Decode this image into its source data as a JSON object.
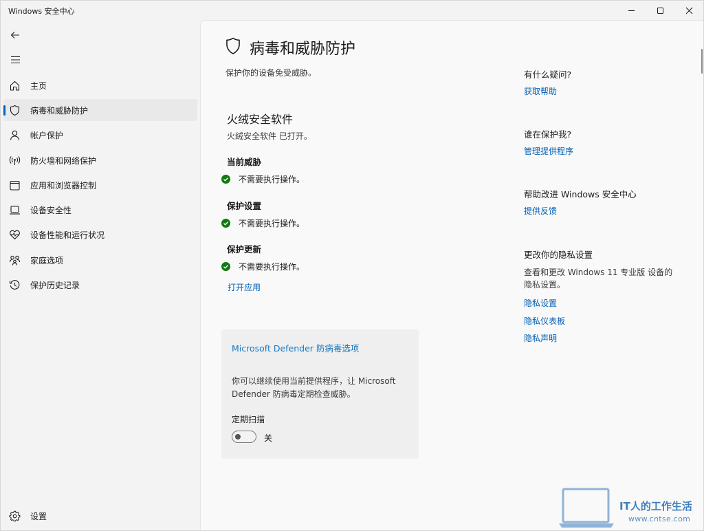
{
  "window": {
    "title": "Windows 安全中心",
    "minimize_icon": "minimize-icon",
    "maximize_icon": "maximize-icon",
    "close_icon": "close-icon"
  },
  "nav": {
    "back_icon": "back-arrow-icon",
    "menu_icon": "hamburger-menu-icon",
    "selected_index": 1,
    "accent_color": "#005fb8",
    "items": [
      {
        "label": "主页",
        "icon": "home-icon"
      },
      {
        "label": "病毒和威胁防护",
        "icon": "shield-icon"
      },
      {
        "label": "帐户保护",
        "icon": "person-icon"
      },
      {
        "label": "防火墙和网络保护",
        "icon": "wifi-antenna-icon"
      },
      {
        "label": "应用和浏览器控制",
        "icon": "app-window-icon"
      },
      {
        "label": "设备安全性",
        "icon": "laptop-icon"
      },
      {
        "label": "设备性能和运行状况",
        "icon": "heart-pulse-icon"
      },
      {
        "label": "家庭选项",
        "icon": "family-icon"
      },
      {
        "label": "保护历史记录",
        "icon": "history-icon"
      }
    ],
    "settings": {
      "label": "设置",
      "icon": "gear-icon"
    }
  },
  "main": {
    "title": "病毒和威胁防护",
    "subtitle": "保护你的设备免受威胁。",
    "provider": {
      "name": "火绒安全软件",
      "status": "火绒安全软件 已打开。",
      "sections": [
        {
          "heading": "当前威胁",
          "status": "不需要执行操作。"
        },
        {
          "heading": "保护设置",
          "status": "不需要执行操作。"
        },
        {
          "heading": "保护更新",
          "status": "不需要执行操作。"
        }
      ],
      "open_app_link": "打开应用"
    },
    "defender_card": {
      "title": "Microsoft Defender 防病毒选项",
      "description": "你可以继续使用当前提供程序，让 Microsoft Defender 防病毒定期检查威胁。",
      "scan_label": "定期扫描",
      "toggle_state": "关",
      "toggle_on": false
    },
    "ok_color": "#0f7b0f"
  },
  "sidebar_right": {
    "help": {
      "heading": "有什么疑问?",
      "link": "获取帮助"
    },
    "who": {
      "heading": "谁在保护我?",
      "link": "管理提供程序"
    },
    "improve": {
      "heading": "帮助改进 Windows 安全中心",
      "link": "提供反馈"
    },
    "privacy": {
      "heading": "更改你的隐私设置",
      "text": "查看和更改 Windows 11 专业版 设备的隐私设置。",
      "links": [
        "隐私设置",
        "隐私仪表板",
        "隐私声明"
      ]
    }
  },
  "watermark": {
    "title": "IT人的工作生活",
    "url": "www.cntse.com",
    "icon": "laptop-logo-icon"
  }
}
